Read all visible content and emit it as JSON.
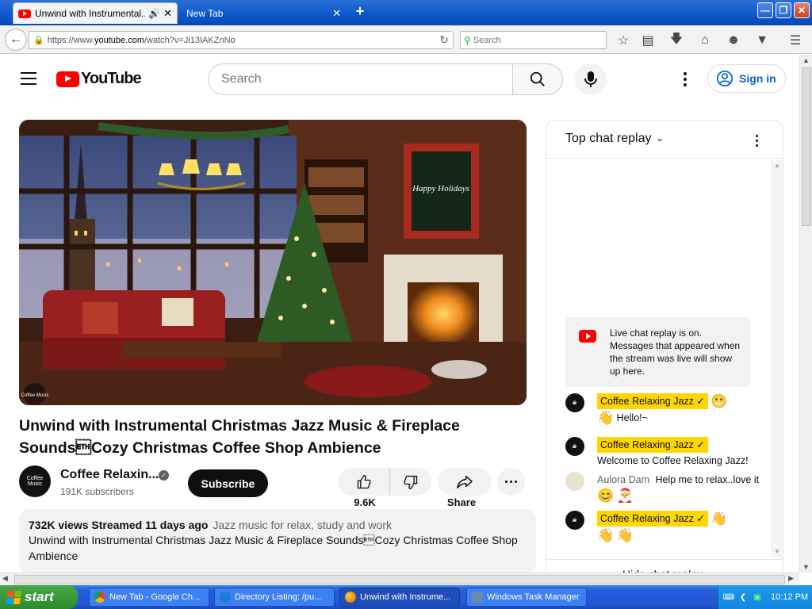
{
  "browser": {
    "tabs": [
      {
        "title": "Unwind with Instrumental...",
        "active": true
      },
      {
        "title": "New Tab",
        "active": false
      }
    ],
    "url_prefix": "https://www.",
    "url_host": "youtube.com",
    "url_path": "/watch?v=Ji13IAKZnNo",
    "search_placeholder": "Search"
  },
  "youtube": {
    "logo_text": "YouTube",
    "search_placeholder": "Search",
    "signin_label": "Sign in"
  },
  "video": {
    "title": "Unwind with Instrumental Christmas Jazz Music & Fireplace Sounds\u0003Cozy Christmas Coffee Shop Ambience",
    "channel_name": "Coffee Relaxin...",
    "subscribers": "191K subscribers",
    "subscribe_label": "Subscribe",
    "like_count": "9.6K",
    "share_label": "Share",
    "avatar_text": "Coffee Music",
    "description": {
      "views": "732K views",
      "streamed": "Streamed 11 days ago",
      "tag": "Jazz music for relax, study and work",
      "text": "Unwind with Instrumental Christmas Jazz Music & Fireplace Sounds\u0003Cozy Christmas Coffee Shop Ambience"
    },
    "player_art": {
      "sign_text": "Happy Holidays",
      "watermark": "Coffee Music"
    }
  },
  "chat": {
    "mode_label": "Top chat replay",
    "replay_notice": "Live chat replay is on. Messages that appeared when the stream was live will show up here.",
    "messages": [
      {
        "author": "Coffee Relaxing Jazz",
        "text": "Hello!~",
        "badge": true
      },
      {
        "author": "Coffee Relaxing Jazz",
        "text": "Welcome to Coffee Relaxing Jazz!",
        "badge": true
      },
      {
        "author": "Aulora Dam",
        "text": "Help me to relax..love it",
        "badge": false
      },
      {
        "author": "Coffee Relaxing Jazz",
        "text": "",
        "badge": true
      }
    ],
    "footer_label": "Hide chat replay"
  },
  "taskbar": {
    "start_label": "start",
    "tasks": [
      {
        "label": "New Tab - Google Ch..."
      },
      {
        "label": "Directory Listing: /pu..."
      },
      {
        "label": "Unwind with Instrume..."
      },
      {
        "label": "Windows Task Manager"
      }
    ],
    "clock": "10:12 PM"
  }
}
